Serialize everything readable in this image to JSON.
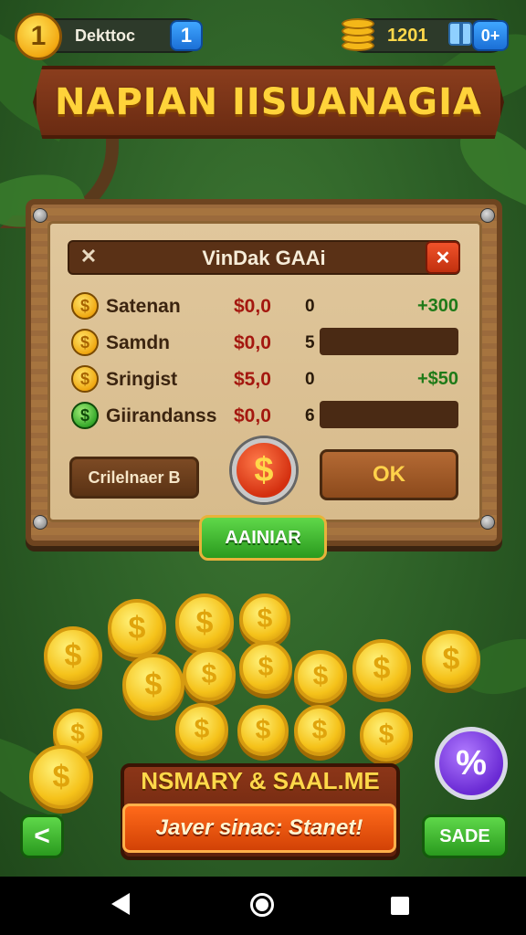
{
  "top_bar": {
    "level": "1",
    "player_name": "Dekttoc",
    "left_badge": "1",
    "coin_count": "1201",
    "right_badge": "0+"
  },
  "title_banner": {
    "title": "NAPIAN IISUANAGIA"
  },
  "dialog": {
    "title": "VinDak GAAi",
    "close_left": "✕",
    "close_right": "✕",
    "rows": [
      {
        "icon": "$",
        "name": "Satenan",
        "price": "$0,0",
        "qty": "0",
        "gain": "+300",
        "coin_color": "gold"
      },
      {
        "icon": "$",
        "name": "Samdn",
        "price": "$0,0",
        "qty": "5",
        "gain": "",
        "coin_color": "gold"
      },
      {
        "icon": "$",
        "name": "Sringist",
        "price": "$5,0",
        "qty": "0",
        "gain": "+$50",
        "coin_color": "gold"
      },
      {
        "icon": "$",
        "name": "Giirandanss",
        "price": "$0,0",
        "qty": "6",
        "gain": "",
        "coin_color": "green"
      }
    ],
    "calendar_button": "Crilelnaer B",
    "dollar_button": "$",
    "ok_button": "OK"
  },
  "main_button": "AAINIAR",
  "coin_symbol": "$",
  "bottom_banner": {
    "title": "NSMARY & SAAL.ME",
    "subtitle": "Javer sinac: Stanet!"
  },
  "buttons": {
    "back": "<",
    "percent": "%",
    "sade": "SADE"
  },
  "colors": {
    "background": "#2c5e26",
    "gold": "#f5c21a",
    "wood": "#9b6a3c",
    "green_button": "#2a9a1e",
    "red_close": "#c1300f"
  }
}
